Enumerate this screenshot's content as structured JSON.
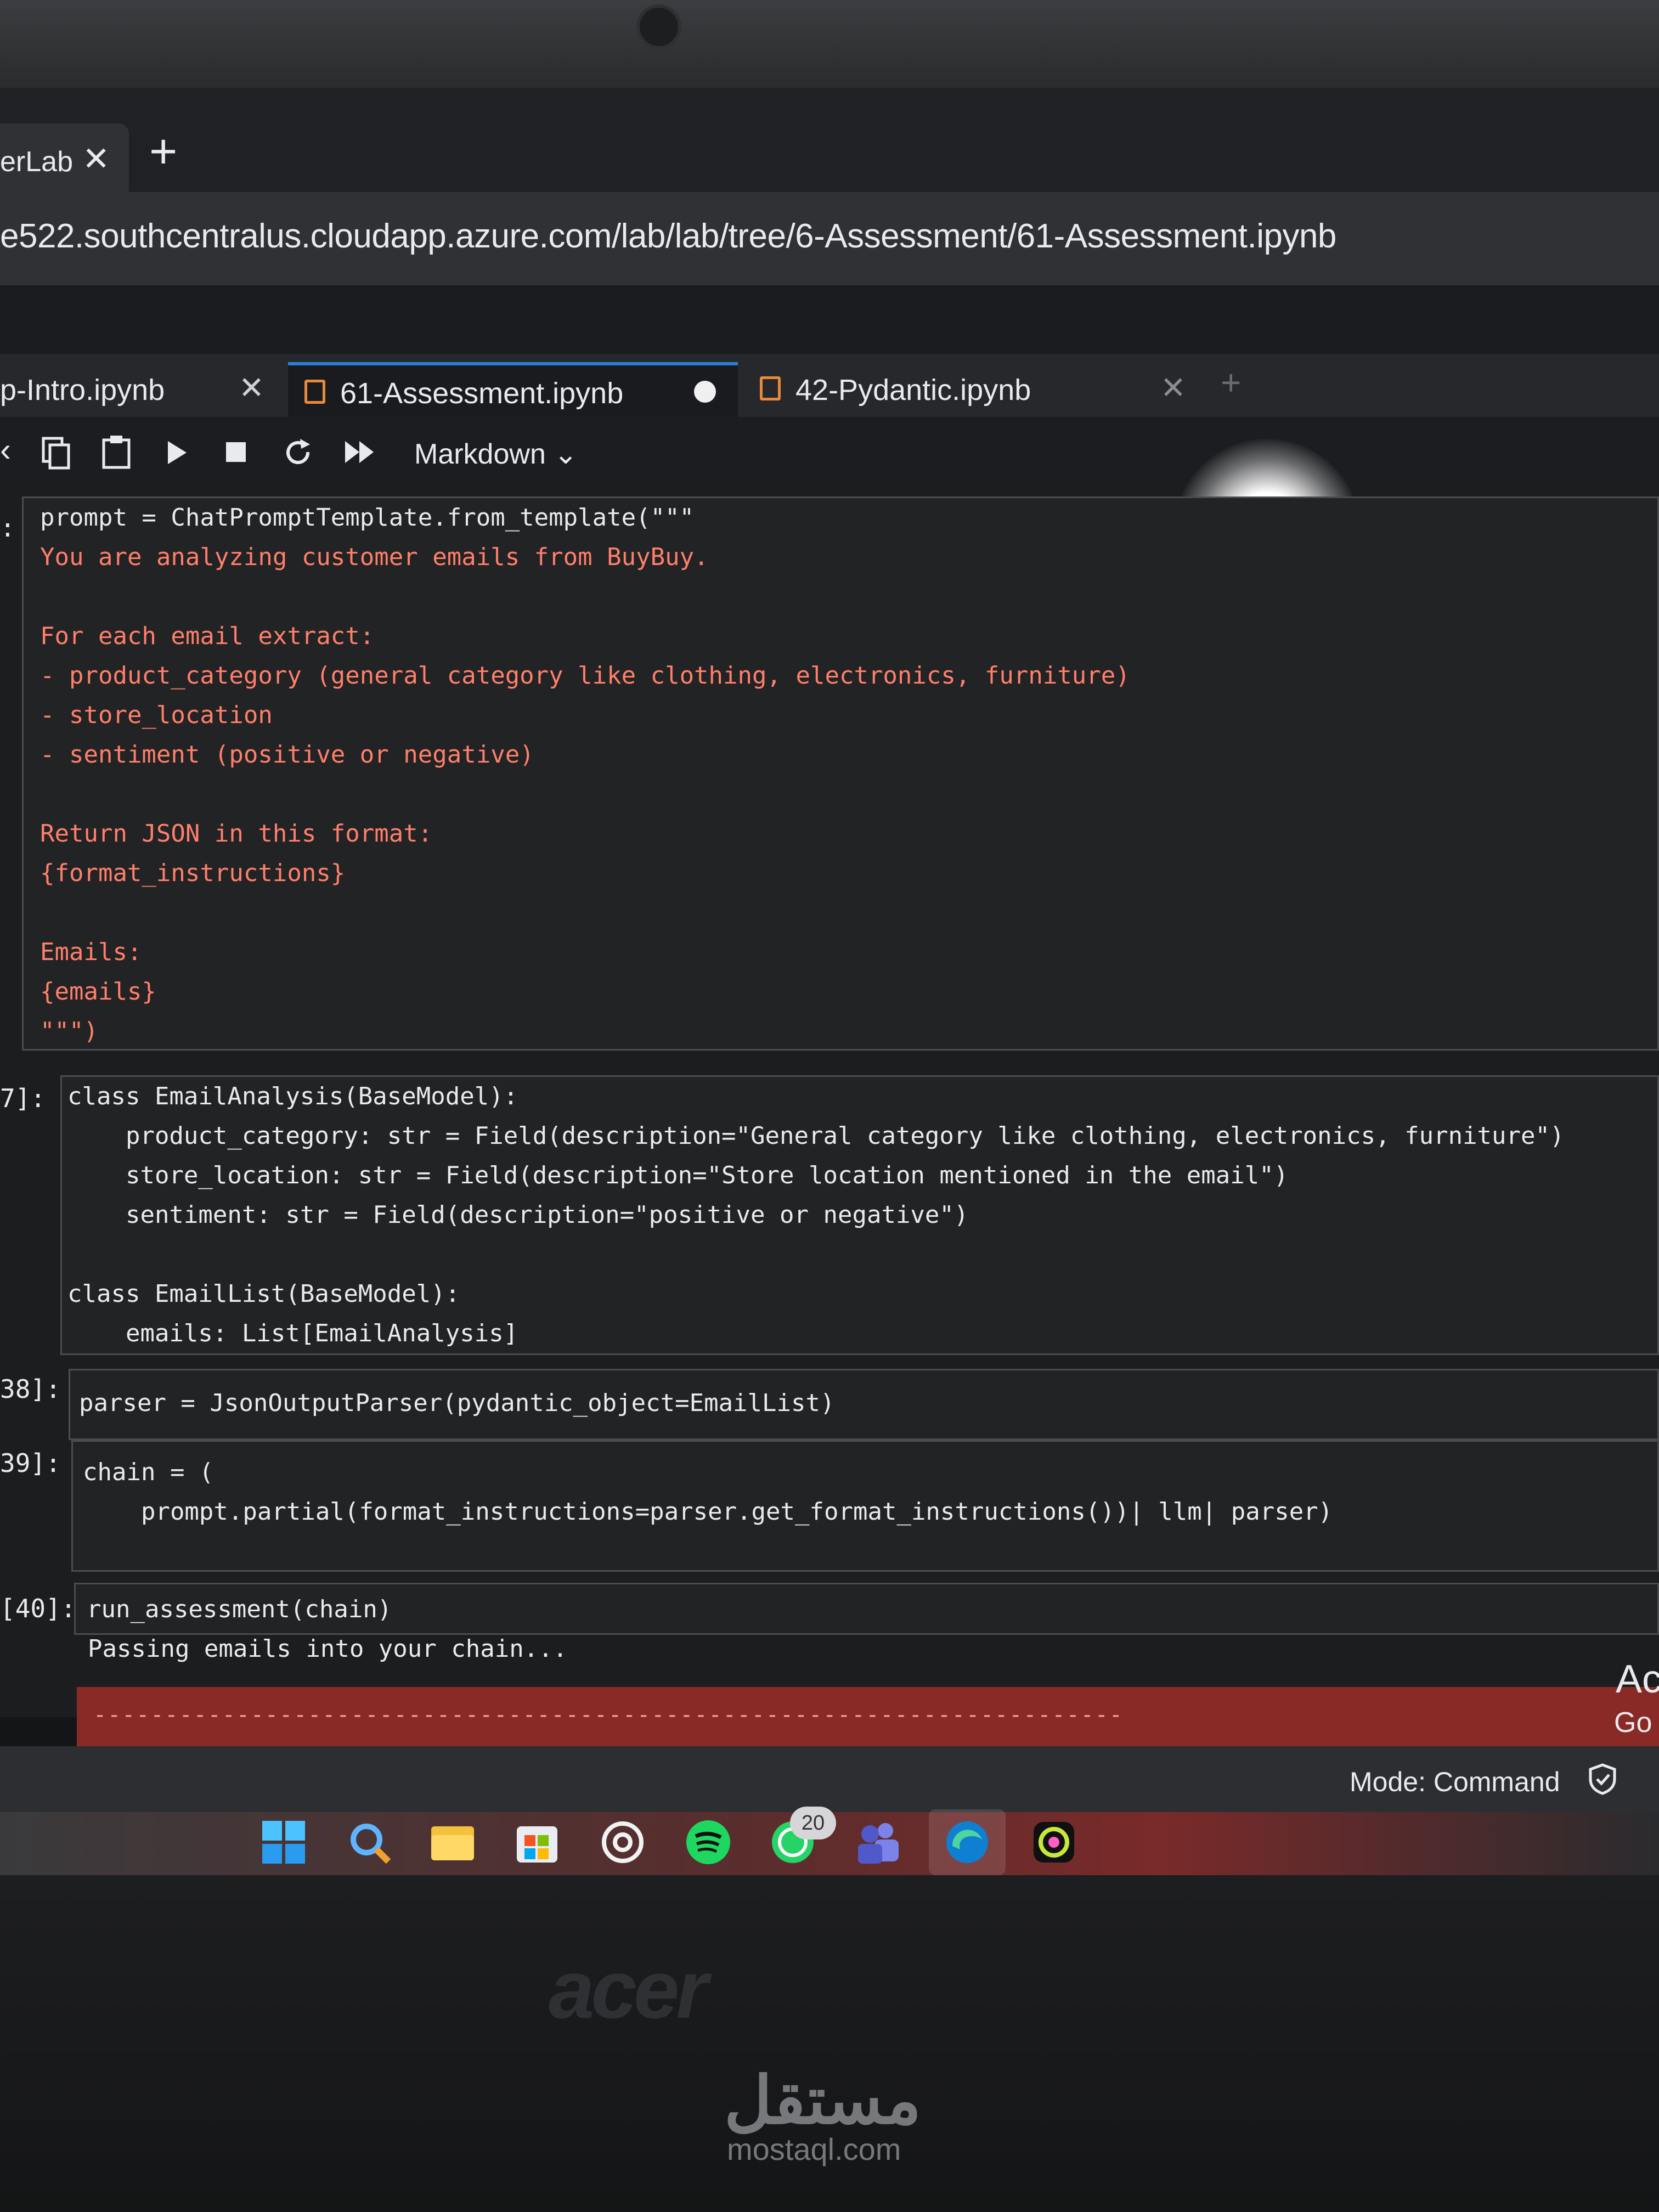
{
  "browser": {
    "tab_title": "erLab",
    "tab_close": "✕",
    "new_tab": "+",
    "url": "e522.southcentralus.cloudapp.azure.com/lab/lab/tree/6-Assessment/61-Assessment.ipynb"
  },
  "notebook_tabs": [
    {
      "label": "p-Intro.ipynb",
      "close": "✕"
    },
    {
      "label": "61-Assessment.ipynb",
      "dirty": "●"
    },
    {
      "label": "42-Pydantic.ipynb",
      "close": "✕"
    }
  ],
  "notebook_tabs_add": "+",
  "toolbar": {
    "cell_type": "Markdown"
  },
  "cells": {
    "c1": {
      "prompt": ":",
      "lines": [
        "prompt = ChatPromptTemplate.from_template(\"\"\"",
        "You are analyzing customer emails from BuyBuy.",
        "",
        "For each email extract:",
        "- product_category (general category like clothing, electronics, furniture)",
        "- store_location",
        "- sentiment (positive or negative)",
        "",
        "Return JSON in this format:",
        "{format_instructions}",
        "",
        "Emails:",
        "{emails}",
        "\"\"\")"
      ]
    },
    "c2": {
      "prompt": "7]:",
      "lines": [
        "class EmailAnalysis(BaseModel):",
        "    product_category: str = Field(description=\"General category like clothing, electronics, furniture\")",
        "    store_location: str = Field(description=\"Store location mentioned in the email\")",
        "    sentiment: str = Field(description=\"positive or negative\")",
        "",
        "class EmailList(BaseModel):",
        "    emails: List[EmailAnalysis]"
      ]
    },
    "c3": {
      "prompt": "38]:",
      "line": "parser = JsonOutputParser(pydantic_object=EmailList)"
    },
    "c4": {
      "prompt": "39]:",
      "lines": [
        "chain = (",
        "    prompt.partial(format_instructions=parser.get_format_instructions())| llm| parser)"
      ]
    },
    "c5": {
      "prompt": "[40]:",
      "line": "run_assessment(chain)",
      "output": "Passing emails into your chain...",
      "error_rule": "------------------------------------------------------------------------"
    }
  },
  "activate_windows": {
    "line1": "Ac",
    "line2": "Go"
  },
  "status": {
    "mode": "Mode: Command"
  },
  "taskbar": {
    "icons": [
      "windows-start-icon",
      "search-icon",
      "file-explorer-icon",
      "microsoft-store-icon",
      "chatgpt-icon",
      "spotify-icon",
      "whatsapp-icon",
      "teams-icon",
      "edge-icon",
      "copilot-icon"
    ],
    "whatsapp_badge": "20"
  },
  "laptop": {
    "brand": "acer"
  },
  "watermark": {
    "arabic": "مستقل",
    "latin": "mostaql.com"
  }
}
